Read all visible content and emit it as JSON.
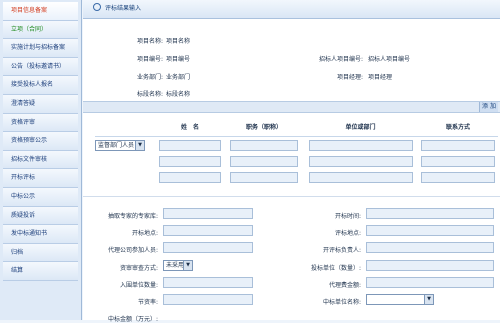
{
  "sidebar": {
    "items": [
      {
        "label": "项目信息备案"
      },
      {
        "label": "立项（合同）"
      },
      {
        "label": "实施计划与招标备案"
      },
      {
        "label": "公告（投标邀请书）"
      },
      {
        "label": "接受投标人报名"
      },
      {
        "label": "澄清答疑"
      },
      {
        "label": "资格评审"
      },
      {
        "label": "资格预审公示"
      },
      {
        "label": "招标文件审核"
      },
      {
        "label": "开标评标"
      },
      {
        "label": "中标公示"
      },
      {
        "label": "质疑投诉"
      },
      {
        "label": "发中标通知书"
      },
      {
        "label": "归档"
      },
      {
        "label": "结算"
      }
    ]
  },
  "main": {
    "title": "评标结果输入",
    "info": {
      "project_name_label": "项目名称:",
      "project_name_value": "项目名称",
      "project_no_label": "项目编号:",
      "project_no_value": "项目编号",
      "tender_no_label": "招标人项目编号:",
      "tender_no_value": "招标人项目编号",
      "dept_label": "业务部门:",
      "dept_value": "业务部门",
      "manager_label": "项目经理:",
      "manager_value": "项目经理",
      "section_label": "标段名称:",
      "section_value": "标段名称"
    },
    "add_button": "添 加",
    "committee": {
      "headers": [
        "姓　名",
        "职务（职称）",
        "单位或部门",
        "联系方式"
      ],
      "role_select": "监督部门人员"
    },
    "form": {
      "expert_source_label": "抽取专家的专家库:",
      "open_time_label": "开标时间:",
      "open_place_label": "开标地点:",
      "eval_place_label": "评标地点:",
      "agency_members_label": "代理公司参加人员:",
      "open_leader_label": "开评标负责人:",
      "qual_method_label": "资审审查方式:",
      "qual_method_value": "未采用",
      "bidder_count_label": "投标单位（数量）:",
      "shortlist_count_label": "入围单位数量:",
      "agency_fee_label": "代理费金额:",
      "saving_rate_label": "节资率:",
      "winner_label": "中标单位名称:"
    },
    "bottom_cut_label": "中标金额（万元）:"
  }
}
